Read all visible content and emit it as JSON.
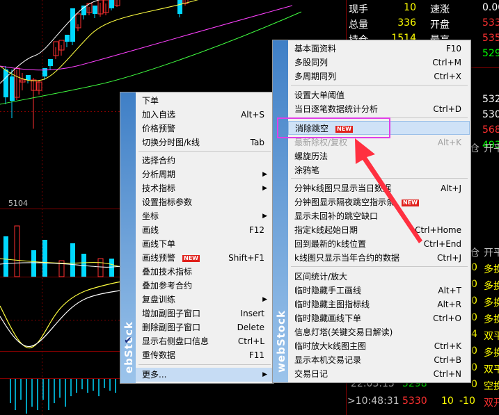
{
  "chart": {
    "price_label": "5104",
    "colors": {
      "bull": "#00d8ff",
      "bear": "#ff3030",
      "ma1": "#ffffff",
      "ma2": "#ffff40",
      "ma3": "#ff40ff",
      "ma4": "#40ff40",
      "grid": "#800000"
    }
  },
  "quote_panel": {
    "rows": [
      {
        "label": "现手",
        "value": "10",
        "label2": "速涨",
        "value2": "0.00",
        "color": "#ffff00",
        "color2": "#ffffff"
      },
      {
        "label": "总量",
        "value": "336",
        "label2": "开盘",
        "value2": "533",
        "color": "#ffff00",
        "color2": "#ff3030"
      },
      {
        "label": "持仓",
        "value": "1514",
        "label2": "最高",
        "value2": "535",
        "color": "#ffff00",
        "color2": "#ff3030"
      },
      {
        "label": "",
        "value": "",
        "label2": "",
        "value2": "529",
        "color": "#ffff00",
        "color2": "#00ff00"
      },
      {
        "label": "",
        "value": "",
        "label2": "",
        "value2": "",
        "color": "#ffff00",
        "color2": "#ffffff"
      },
      {
        "label": "",
        "value": "",
        "label2": "",
        "value2": "532",
        "color": "#ffff00",
        "color2": "#ffffff"
      },
      {
        "label": "",
        "value": "",
        "label2": "",
        "value2": "530",
        "color": "#ffff00",
        "color2": "#ffffff"
      },
      {
        "label": "",
        "value": "",
        "label2": "",
        "value2": "568",
        "color": "#ffff00",
        "color2": "#ff3030"
      },
      {
        "label": "",
        "value": "",
        "label2": "",
        "value2": "493",
        "color": "#ffff00",
        "color2": "#00ff00"
      }
    ],
    "header1": {
      "a": "仓",
      "b": "开平"
    },
    "header2": {
      "a": "仓",
      "b": "开平"
    },
    "trades": [
      {
        "v": "0",
        "t": "多换"
      },
      {
        "v": "0",
        "t": "多换"
      },
      {
        "v": "0",
        "t": "多换"
      },
      {
        "v": "0",
        "t": "多换"
      },
      {
        "v": "4",
        "t": "双平"
      },
      {
        "v": "0",
        "t": "多换"
      },
      {
        "v": "0",
        "t": "双平"
      },
      {
        "v": "0",
        "t": "空换"
      }
    ],
    "tick_rows": [
      {
        "time": "22:03:15",
        "price": "5298"
      },
      {
        "time": ">10:48:31",
        "price": "5330",
        "vol": "10",
        "chg": "-10",
        "type": "双开"
      }
    ]
  },
  "menu_left": {
    "brand": "ebStock",
    "items": [
      {
        "label": "下单",
        "shortcut": ""
      },
      {
        "label": "加入自选",
        "shortcut": "Alt+S"
      },
      {
        "label": "价格预警",
        "shortcut": ""
      },
      {
        "label": "切换分时图/k线",
        "shortcut": "Tab"
      },
      {
        "label": "选择合约",
        "shortcut": ""
      },
      {
        "label": "分析周期",
        "shortcut": ""
      },
      {
        "label": "技术指标",
        "shortcut": ""
      },
      {
        "label": "设置指标参数",
        "shortcut": ""
      },
      {
        "label": "坐标",
        "shortcut": ""
      },
      {
        "label": "画线",
        "shortcut": "F12"
      },
      {
        "label": "画线下单",
        "shortcut": ""
      },
      {
        "label": "画线预警",
        "shortcut": "Shift+F1",
        "badge": "NEW"
      },
      {
        "label": "叠加技术指标",
        "shortcut": ""
      },
      {
        "label": "叠加参考合约",
        "shortcut": ""
      },
      {
        "label": "复盘训练",
        "shortcut": ""
      },
      {
        "label": "增加副图子窗口",
        "shortcut": "Insert"
      },
      {
        "label": "删除副图子窗口",
        "shortcut": "Delete"
      },
      {
        "label": "显示右侧盘口信息",
        "shortcut": "Ctrl+L"
      },
      {
        "label": "重传数据",
        "shortcut": "F11"
      },
      {
        "label": "更多...",
        "shortcut": ""
      }
    ]
  },
  "menu_right": {
    "brand": "webStock",
    "items": [
      {
        "label": "基本面资料",
        "shortcut": "F10"
      },
      {
        "label": "多股同列",
        "shortcut": "Ctrl+M"
      },
      {
        "label": "多周期同列",
        "shortcut": "Ctrl+X"
      },
      {
        "label": "设置大单阈值",
        "shortcut": ""
      },
      {
        "label": "当日逐笔数据统计分析",
        "shortcut": "Ctrl+D"
      },
      {
        "label": "消除跳空",
        "shortcut": "",
        "badge": "NEW"
      },
      {
        "label": "最新除权/复权",
        "shortcut": "Alt+K"
      },
      {
        "label": "螺旋历法",
        "shortcut": ""
      },
      {
        "label": "涂鸦笔",
        "shortcut": ""
      },
      {
        "label": "分钟k线图只显示当日数据",
        "shortcut": "Alt+J"
      },
      {
        "label": "分钟图显示隔夜跳空指示条",
        "shortcut": "",
        "badge": "NEW"
      },
      {
        "label": "显示未回补的跳空缺口",
        "shortcut": ""
      },
      {
        "label": "指定k线起始日期",
        "shortcut": "Ctrl+Home"
      },
      {
        "label": "回到最新的k线位置",
        "shortcut": "Ctrl+End"
      },
      {
        "label": "k线图只显示当年合约的数据",
        "shortcut": "Ctrl+J"
      },
      {
        "label": "区间统计/放大",
        "shortcut": ""
      },
      {
        "label": "临时隐藏手工画线",
        "shortcut": "Alt+T"
      },
      {
        "label": "临时隐藏主图指标线",
        "shortcut": "Alt+R"
      },
      {
        "label": "临时隐藏画线下单",
        "shortcut": "Ctrl+O"
      },
      {
        "label": "信息灯塔(关键交易日解读)",
        "shortcut": ""
      },
      {
        "label": "临时放大k线图主图",
        "shortcut": "Ctrl+K"
      },
      {
        "label": "显示本机交易记录",
        "shortcut": "Ctrl+B"
      },
      {
        "label": "交易日记",
        "shortcut": "Ctrl+N"
      }
    ]
  }
}
